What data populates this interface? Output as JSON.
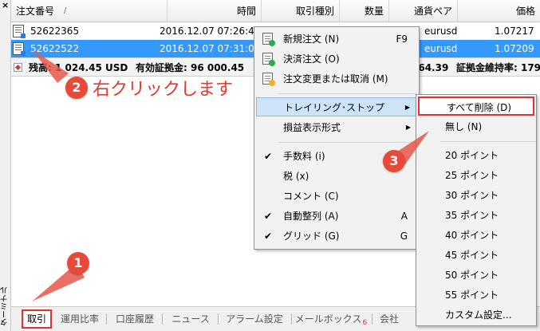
{
  "sidebar": {
    "close_glyph": "×",
    "vertical_label": "ターミナル"
  },
  "table": {
    "headers": {
      "ticket": "注文番号",
      "sort_glyph": "/",
      "time": "時間",
      "type": "取引種別",
      "volume": "数量",
      "symbol": "通貨ペア",
      "price": "価格"
    },
    "rows": [
      {
        "ticket": "52622365",
        "time": "2016.12.07 07:26:40",
        "symbol": "eurusd",
        "price": "1.07217"
      },
      {
        "ticket": "52622522",
        "time": "2016.12.07 07:31:04",
        "symbol": "eurusd",
        "price": "1.07209"
      }
    ],
    "summary": {
      "balance": "残高: 1 024.45 USD",
      "equity": "有効証拠金: 96 000.45",
      "margin": "464.39",
      "margin_level": "証拠金維持率: 179"
    }
  },
  "context_menu": {
    "items": [
      {
        "label": "新規注文 (N)",
        "shortcut": "F9",
        "icon": "new-order-icon"
      },
      {
        "label": "決済注文 (O)",
        "icon": "close-order-icon"
      },
      {
        "label": "注文変更または取消 (M)",
        "icon": "modify-order-icon"
      },
      {
        "label": "トレイリング･ストップ",
        "has_submenu": true
      },
      {
        "label": "損益表示形式",
        "has_submenu": true
      },
      {
        "label": "手数料 (i)",
        "checked": true
      },
      {
        "label": "税 (x)",
        "checked": false
      },
      {
        "label": "コメント (C)",
        "checked": false
      },
      {
        "label": "自動整列 (A)",
        "shortcut": "A",
        "checked": true
      },
      {
        "label": "グリッド (G)",
        "shortcut": "G",
        "checked": true
      }
    ],
    "check_glyph": "✔",
    "arrow_glyph": "▶"
  },
  "submenu": {
    "items": [
      "すべて削除 (D)",
      "無し (N)",
      "20 ポイント",
      "25 ポイント",
      "30 ポイント",
      "35 ポイント",
      "40 ポイント",
      "45 ポイント",
      "50 ポイント",
      "55 ポイント",
      "カスタム設定..."
    ]
  },
  "tabs": [
    {
      "label": "取引",
      "active": true
    },
    {
      "label": "運用比率"
    },
    {
      "label": "口座履歴"
    },
    {
      "label": "ニュース"
    },
    {
      "label": "アラーム設定"
    },
    {
      "label": "メールボックス",
      "badge": "6"
    },
    {
      "label": "会社"
    }
  ],
  "annotations": {
    "step1": "1",
    "step2": "2",
    "step2_text": "右クリックします",
    "step3": "3"
  },
  "colors": {
    "selection": "#3399ff",
    "highlight_red": "#e03030",
    "badge_red": "#e84a3a",
    "menu_hover": "#cde3f8"
  }
}
